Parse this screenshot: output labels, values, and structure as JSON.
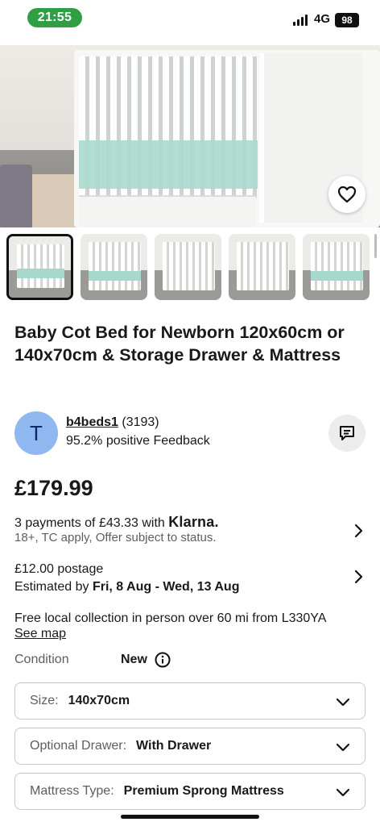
{
  "status_bar": {
    "time": "21:55",
    "network": "4G",
    "battery": "98"
  },
  "product": {
    "image_count_thumbnails": 5,
    "title": "Baby Cot Bed for Newborn 120x60cm or 140x70cm & Storage Drawer & Mattress",
    "price": "£179.99"
  },
  "seller": {
    "avatar_letter": "T",
    "name": "b4beds1",
    "rating_count": "(3193)",
    "feedback": "95.2% positive Feedback"
  },
  "payments": {
    "text_prefix": "3 payments of £43.33 with",
    "provider": "Klarna.",
    "note": "18+, TC apply, Offer subject to status."
  },
  "postage": {
    "price": "£12.00 postage",
    "estimate_prefix": "Estimated by",
    "estimate_dates": "Fri, 8 Aug - Wed, 13 Aug"
  },
  "collection": {
    "text": "Free local collection in person over 60 mi from L330YA",
    "link": "See map"
  },
  "condition": {
    "label": "Condition",
    "value": "New"
  },
  "options": [
    {
      "label": "Size:",
      "value": "140x70cm"
    },
    {
      "label": "Optional Drawer:",
      "value": "With Drawer"
    },
    {
      "label": "Mattress Type:",
      "value": "Premium Sprong Mattress"
    }
  ],
  "icons": {
    "heart": "heart-icon",
    "message": "message-icon",
    "chevron": "chevron-right-icon",
    "info": "info-icon",
    "dropdown": "chevron-down-icon"
  }
}
